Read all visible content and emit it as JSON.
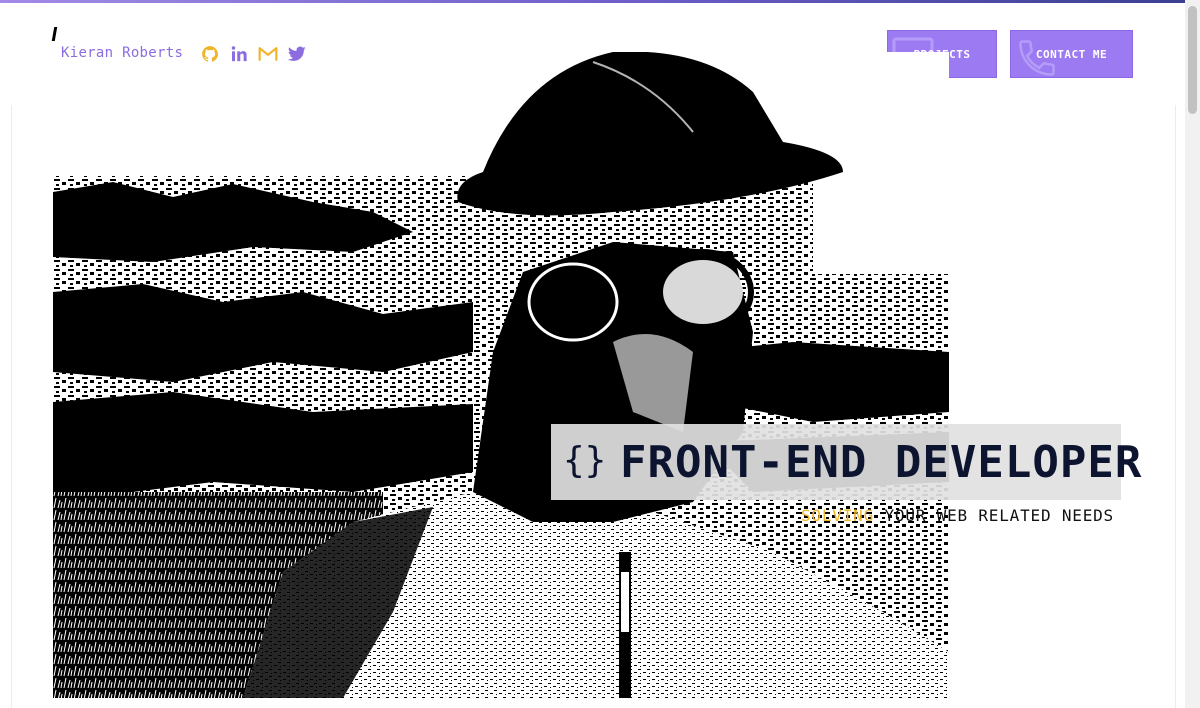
{
  "header": {
    "name": "Kieran Roberts",
    "socials": [
      {
        "icon": "github-icon",
        "color": "#f0b429"
      },
      {
        "icon": "linkedin-icon",
        "color": "#8c6ce0"
      },
      {
        "icon": "gmail-icon",
        "color": "#f0b429"
      },
      {
        "icon": "twitter-icon",
        "color": "#8c6ce0"
      }
    ],
    "nav": {
      "projects_label": "PROJECTS",
      "projects_icon": "monitor-icon",
      "contact_label": "CONTACT ME",
      "contact_icon": "phone-icon"
    }
  },
  "hero": {
    "image": "monochrome-portrait-photo",
    "title_prefix": "{}",
    "title": "FRONT-END DEVELOPER",
    "subtitle_accent": "SOLVING",
    "subtitle_rest": "YOUR WEB RELATED NEEDS"
  },
  "colors": {
    "accent_purple": "#9c7af2",
    "accent_yellow": "#f0b429",
    "title_navy": "#0c1430"
  }
}
